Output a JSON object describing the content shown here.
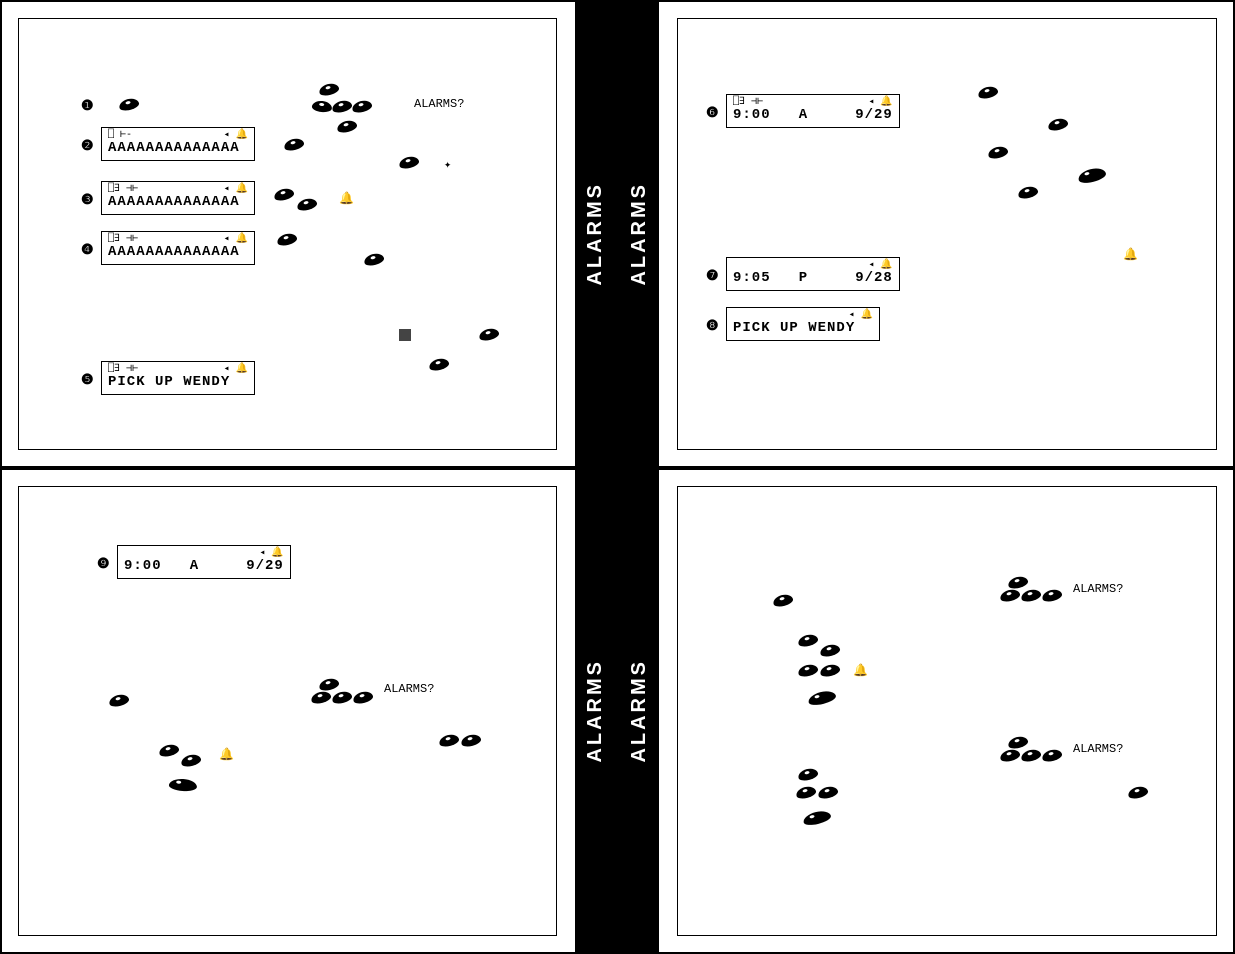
{
  "tab_label": "ALARMS",
  "prompt": "ALARMS?",
  "markers": {
    "m1": "❶",
    "m2": "❷",
    "m3": "❸",
    "m4": "❹",
    "m5": "❺",
    "m6": "❻",
    "m7": "❼",
    "m8": "❽",
    "m9": "❾"
  },
  "icons": {
    "indicator_empty": "⎕ ⊢-",
    "indicator_full": "⎕∃ ⊣⊢",
    "back_bell": "◂ 🔔"
  },
  "lcd": {
    "step2": {
      "top_left": "⎕ ⊢-",
      "top_right": "◂ 🔔",
      "line": "AAAAAAAAAAAAAA"
    },
    "step3": {
      "top_left": "⎕∃ ⊣⊢",
      "top_right": "◂ 🔔",
      "line": "AAAAAAAAAAAAAA"
    },
    "step4": {
      "top_left": "⎕∃ ⊣⊢",
      "top_right": "◂ 🔔",
      "line": "AAAAAAAAAAAAAA"
    },
    "step5": {
      "top_left": "⎕∃ ⊣⊢",
      "top_right": "◂ 🔔",
      "line": "PICK UP WENDY"
    },
    "step6": {
      "top_left": "⎕∃ ⊣⊢",
      "top_right": "◂ 🔔",
      "line": "9:00   A     9/29"
    },
    "step7": {
      "top_left": "",
      "top_right": "◂ 🔔",
      "line": "9:05   P     9/28"
    },
    "step8": {
      "top_left": "",
      "top_right": "◂ 🔔",
      "line": "PICK UP WENDY"
    },
    "step9": {
      "top_left": "",
      "top_right": "◂ 🔔",
      "line": "9:00   A     9/29"
    }
  },
  "bell_glyph": "🔔",
  "cross_glyph": "✦"
}
